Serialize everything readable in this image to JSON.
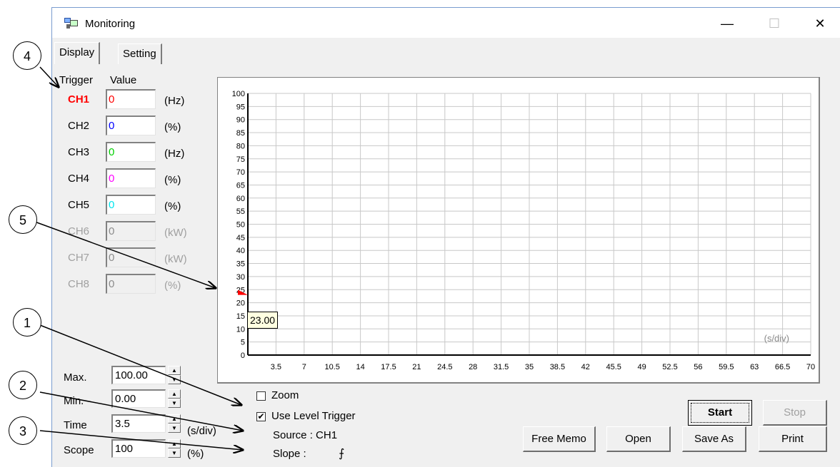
{
  "window": {
    "title": "Monitoring",
    "minimize": "—",
    "maximize": "☐",
    "close": "✕"
  },
  "tabs": [
    {
      "label": "Display"
    },
    {
      "label": "Setting"
    }
  ],
  "headers": {
    "trigger": "Trigger",
    "value": "Value"
  },
  "channels": [
    {
      "label": "CH1",
      "value": "0",
      "unit": "(Hz)",
      "color": "#ff0000",
      "enabled": true
    },
    {
      "label": "CH2",
      "value": "0",
      "unit": "(%)",
      "color": "#0000ff",
      "enabled": true
    },
    {
      "label": "CH3",
      "value": "0",
      "unit": "(Hz)",
      "color": "#00d000",
      "enabled": true
    },
    {
      "label": "CH4",
      "value": "0",
      "unit": "(%)",
      "color": "#ff00ff",
      "enabled": true
    },
    {
      "label": "CH5",
      "value": "0",
      "unit": "(%)",
      "color": "#00e5ee",
      "enabled": true
    },
    {
      "label": "CH6",
      "value": "0",
      "unit": "(kW)",
      "color": "#8c8c8c",
      "enabled": false
    },
    {
      "label": "CH7",
      "value": "0",
      "unit": "(kW)",
      "color": "#8c8c8c",
      "enabled": false
    },
    {
      "label": "CH8",
      "value": "0",
      "unit": "(%)",
      "color": "#8c8c8c",
      "enabled": false
    }
  ],
  "chart_data": {
    "type": "line",
    "y_ticks": [
      "100",
      "95",
      "90",
      "85",
      "80",
      "75",
      "70",
      "65",
      "60",
      "55",
      "50",
      "45",
      "40",
      "35",
      "30",
      "25",
      "20",
      "15",
      "10",
      "5",
      "0"
    ],
    "x_ticks": [
      "3.5",
      "7",
      "10.5",
      "14",
      "17.5",
      "21",
      "24.5",
      "28",
      "31.5",
      "35",
      "38.5",
      "42",
      "45.5",
      "49",
      "52.5",
      "56",
      "59.5",
      "63",
      "66.5",
      "70"
    ],
    "ylim": [
      0,
      100
    ],
    "xlim": [
      0,
      70
    ],
    "x_unit_label": "(s/div)",
    "grid": true,
    "trigger_level": 23,
    "trigger_marker_color": "#ff0000",
    "trigger_tooltip": "23.00",
    "series": []
  },
  "controls": {
    "max_label": "Max.",
    "max_value": "100.00",
    "min_label": "Min.",
    "min_value": "0.00",
    "time_label": "Time",
    "time_value": "3.5",
    "time_unit": "(s/div)",
    "scope_label": "Scope",
    "scope_value": "100",
    "scope_unit": "(%)"
  },
  "trigger": {
    "zoom_label": "Zoom",
    "zoom_checked": false,
    "use_level_label": "Use Level Trigger",
    "use_level_checked": true,
    "source_text": "Source : CH1",
    "slope_label": "Slope :",
    "slope_symbol": "⨍"
  },
  "buttons": {
    "start": "Start",
    "stop": "Stop",
    "free_memo": "Free Memo",
    "open": "Open",
    "save_as": "Save As",
    "print": "Print"
  },
  "callouts": [
    "1",
    "2",
    "3",
    "4",
    "5"
  ]
}
